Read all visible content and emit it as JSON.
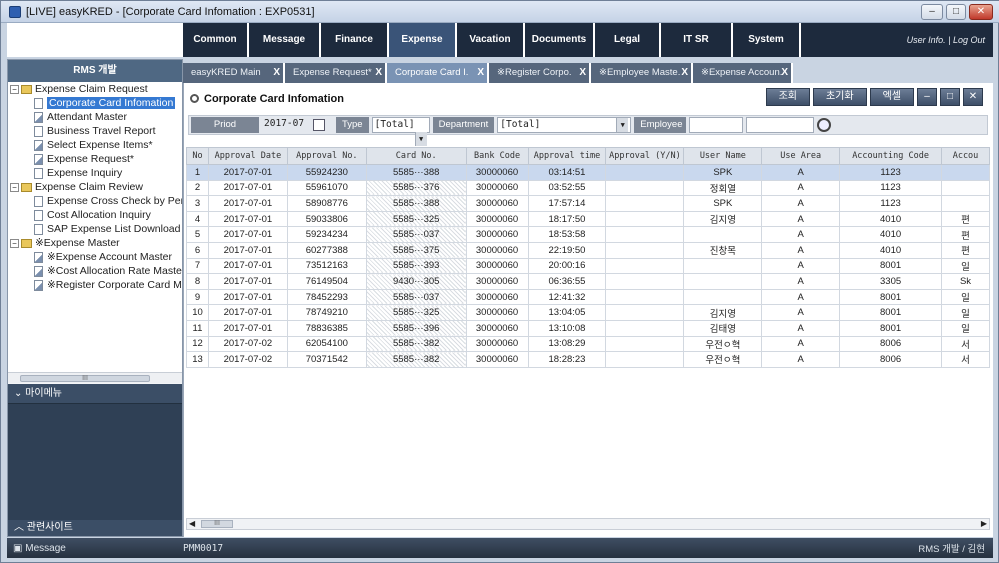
{
  "window": {
    "title": "[LIVE] easyKRED   - [Corporate Card Infomation : EXP0531]",
    "controls": [
      "minimize",
      "restore",
      "close"
    ]
  },
  "nav": {
    "items": [
      "Common",
      "Message",
      "Finance",
      "Expense",
      "Vacation",
      "Documents",
      "Legal",
      "IT SR",
      "System"
    ],
    "active": "Expense",
    "user_links": "User Info. | Log Out"
  },
  "sidebar": {
    "header": "RMS 개발",
    "tree": [
      {
        "level": 0,
        "type": "folder",
        "label": "Expense Claim Request"
      },
      {
        "level": 1,
        "type": "doc",
        "label": "Corporate Card Infomation",
        "selected": true
      },
      {
        "level": 1,
        "type": "edit",
        "label": "Attendant Master"
      },
      {
        "level": 1,
        "type": "doc",
        "label": "Business Travel Report"
      },
      {
        "level": 1,
        "type": "edit",
        "label": "Select Expense Items*"
      },
      {
        "level": 1,
        "type": "edit",
        "label": "Expense Request*"
      },
      {
        "level": 1,
        "type": "doc",
        "label": "Expense Inquiry"
      },
      {
        "level": 0,
        "type": "folder",
        "label": "Expense Claim Review"
      },
      {
        "level": 1,
        "type": "doc",
        "label": "Expense Cross Check by Pers"
      },
      {
        "level": 1,
        "type": "doc",
        "label": "Cost Allocation Inquiry"
      },
      {
        "level": 1,
        "type": "doc",
        "label": "SAP Expense List Download"
      },
      {
        "level": 0,
        "type": "folder",
        "label": "※Expense Master"
      },
      {
        "level": 1,
        "type": "edit",
        "label": "※Expense Account Master"
      },
      {
        "level": 1,
        "type": "edit",
        "label": "※Cost Allocation Rate Master"
      },
      {
        "level": 1,
        "type": "edit",
        "label": "※Register Corporate Card Ma"
      }
    ],
    "scroll_thumb": "III",
    "my_menu": "마이메뉴",
    "related_sites": "관련사이트"
  },
  "tabs": [
    {
      "label": "easyKRED Main",
      "close": "X",
      "active": false
    },
    {
      "label": "Expense Request*",
      "close": "X",
      "active": false
    },
    {
      "label": "Corporate Card I.",
      "close": "X",
      "active": true
    },
    {
      "label": "※Register Corpo.",
      "close": "X",
      "active": false
    },
    {
      "label": "※Employee Maste.",
      "close": "X",
      "active": false
    },
    {
      "label": "※Expense Accoun.",
      "close": "X",
      "active": false
    }
  ],
  "page": {
    "title": "Corporate Card Infomation",
    "buttons": {
      "search": "조회",
      "reset": "초기화",
      "excel": "엑셀"
    }
  },
  "filter": {
    "period_label": "Priod",
    "period_value": "2017-07",
    "type_label": "Type",
    "type_value": "[Total]",
    "department_label": "Department",
    "department_value": "[Total]",
    "employee_label": "Employee",
    "employee_value": "",
    "employee_value2": ""
  },
  "table": {
    "columns": [
      "No",
      "Approval Date",
      "Approval No.",
      "Card No.",
      "Bank Code",
      "Approval time",
      "Approval (Y/N)",
      "User Name",
      "Use Area",
      "Accounting Code",
      "Accou"
    ],
    "rows": [
      [
        "1",
        "2017-07-01",
        "55924230",
        "5585···388",
        "30000060",
        "03:14:51",
        "",
        "SPK",
        "A",
        "1123",
        ""
      ],
      [
        "2",
        "2017-07-01",
        "55961070",
        "5585···376",
        "30000060",
        "03:52:55",
        "",
        "정회열",
        "A",
        "1123",
        ""
      ],
      [
        "3",
        "2017-07-01",
        "58908776",
        "5585···388",
        "30000060",
        "17:57:14",
        "",
        "SPK",
        "A",
        "1123",
        ""
      ],
      [
        "4",
        "2017-07-01",
        "59033806",
        "5585···325",
        "30000060",
        "18:17:50",
        "",
        "김지영",
        "A",
        "4010",
        "편"
      ],
      [
        "5",
        "2017-07-01",
        "59234234",
        "5585···037",
        "30000060",
        "18:53:58",
        "",
        "",
        "A",
        "4010",
        "편"
      ],
      [
        "6",
        "2017-07-01",
        "60277388",
        "5585···375",
        "30000060",
        "22:19:50",
        "",
        "진창목",
        "A",
        "4010",
        "편"
      ],
      [
        "7",
        "2017-07-01",
        "73512163",
        "5585···393",
        "30000060",
        "20:00:16",
        "",
        "",
        "A",
        "8001",
        "일"
      ],
      [
        "8",
        "2017-07-01",
        "76149504",
        "9430···305",
        "30000060",
        "06:36:55",
        "",
        "",
        "A",
        "3305",
        "Sk"
      ],
      [
        "9",
        "2017-07-01",
        "78452293",
        "5585···037",
        "30000060",
        "12:41:32",
        "",
        "",
        "A",
        "8001",
        "일"
      ],
      [
        "10",
        "2017-07-01",
        "78749210",
        "5585···325",
        "30000060",
        "13:04:05",
        "",
        "김지영",
        "A",
        "8001",
        "일"
      ],
      [
        "11",
        "2017-07-01",
        "78836385",
        "5585···396",
        "30000060",
        "13:10:08",
        "",
        "김태영",
        "A",
        "8001",
        "일"
      ],
      [
        "12",
        "2017-07-02",
        "62054100",
        "5585···382",
        "30000060",
        "13:08:29",
        "",
        "우전ㅇ혁",
        "A",
        "8006",
        "서"
      ],
      [
        "13",
        "2017-07-02",
        "70371542",
        "5585···382",
        "30000060",
        "18:28:23",
        "",
        "우전ㅇ혁",
        "A",
        "8006",
        "서"
      ]
    ],
    "selected_row": 1,
    "hscroll_thumb": "III"
  },
  "status": {
    "message": "Message",
    "code": "PMM0017",
    "user": "RMS 개발 / 김현"
  },
  "colors": {
    "nav_bg": "#1d2a3d",
    "nav_active": "#3a5478",
    "selection": "#3579d2",
    "row_selected": "#c9d8ee"
  }
}
